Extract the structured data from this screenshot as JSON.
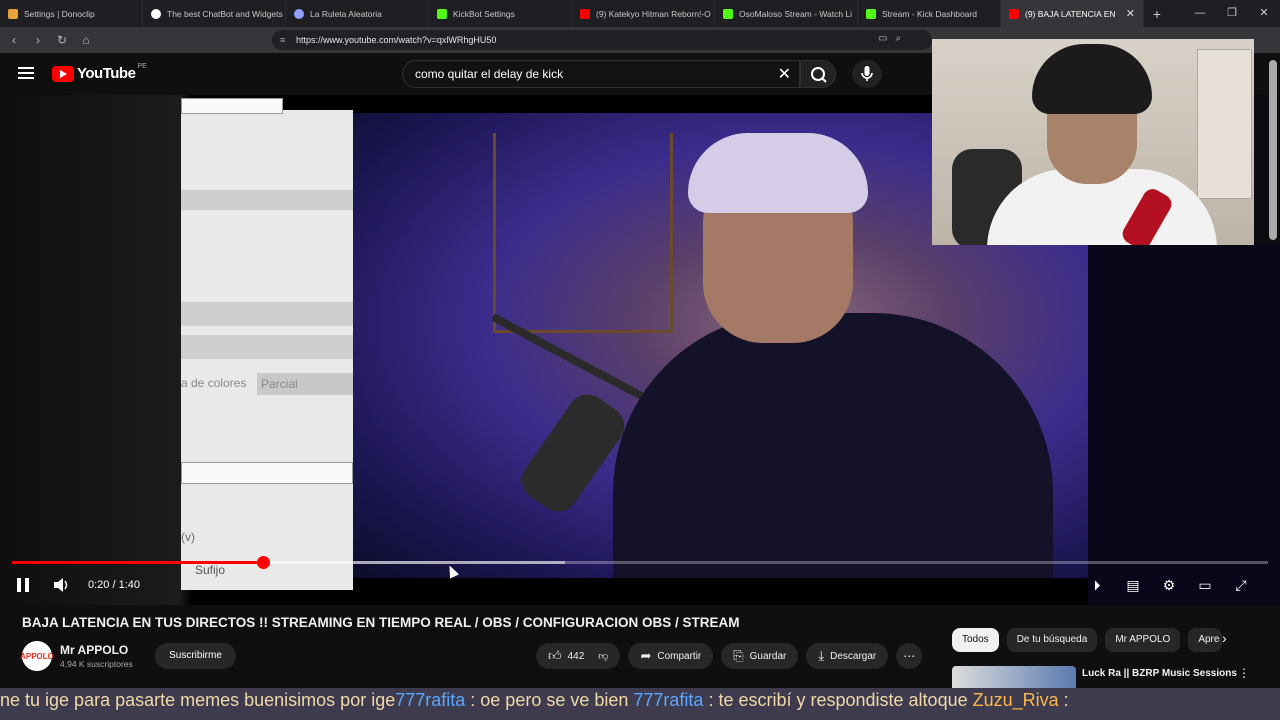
{
  "browser": {
    "tabs": [
      {
        "label": "Settings | Donoclip",
        "color": "#e8a33a"
      },
      {
        "label": "The best ChatBot and Widgets",
        "color": "#ffffff"
      },
      {
        "label": "La Ruleta Aleatoria",
        "color": "#8fa0ff"
      },
      {
        "label": "KickBot Settings",
        "color": "#53fc18"
      },
      {
        "label": "(9) Katekyo Hitman Reborn!-O",
        "color": "#ff0000"
      },
      {
        "label": "OsoMaloso Stream - Watch Li",
        "color": "#53fc18"
      },
      {
        "label": "Stream - Kick Dashboard",
        "color": "#53fc18"
      },
      {
        "label": "(9) BAJA LATENCIA EN",
        "color": "#ff0000"
      }
    ],
    "url": "https://www.youtube.com/watch?v=qxlWRhgHU50"
  },
  "youtube": {
    "logo_text": "YouTube",
    "country_code": "PE",
    "search_query": "como quitar el delay de kick"
  },
  "player": {
    "time_display": "0:20 / 1:40",
    "progress_fraction": 0.2,
    "buffered_fraction": 0.44,
    "screen_label_1": "a de colores",
    "screen_label_2": "Parcial",
    "screen_label_3": "(v)",
    "screen_label_4": "Sufijo"
  },
  "video": {
    "title": "BAJA LATENCIA EN TUS DIRECTOS !! STREAMING EN TIEMPO REAL / OBS / CONFIGURACION OBS / STREAM",
    "channel_name": "Mr APPOLO",
    "channel_avatar_text": "APPOLO",
    "subscribers": "4,94 K suscriptores",
    "subscribe_label": "Suscribirme",
    "likes": "442",
    "share_label": "Compartir",
    "save_label": "Guardar",
    "download_label": "Descargar"
  },
  "chips": [
    "Todos",
    "De tu búsqueda",
    "Mr APPOLO",
    "Apre"
  ],
  "recommendation": {
    "title": "Luck Ra || BZRP Music Sessions"
  },
  "chat_ticker": {
    "seg1": "ne tu ige para pasarte memes buenisimos por ige",
    "user1": "777rafita",
    "seg2": " : oe pero se ve bien ",
    "user2": "777rafita",
    "seg3": " : te escribí y respondiste altoque ",
    "user3": "Zuzu_Riva",
    "seg4": " :"
  }
}
